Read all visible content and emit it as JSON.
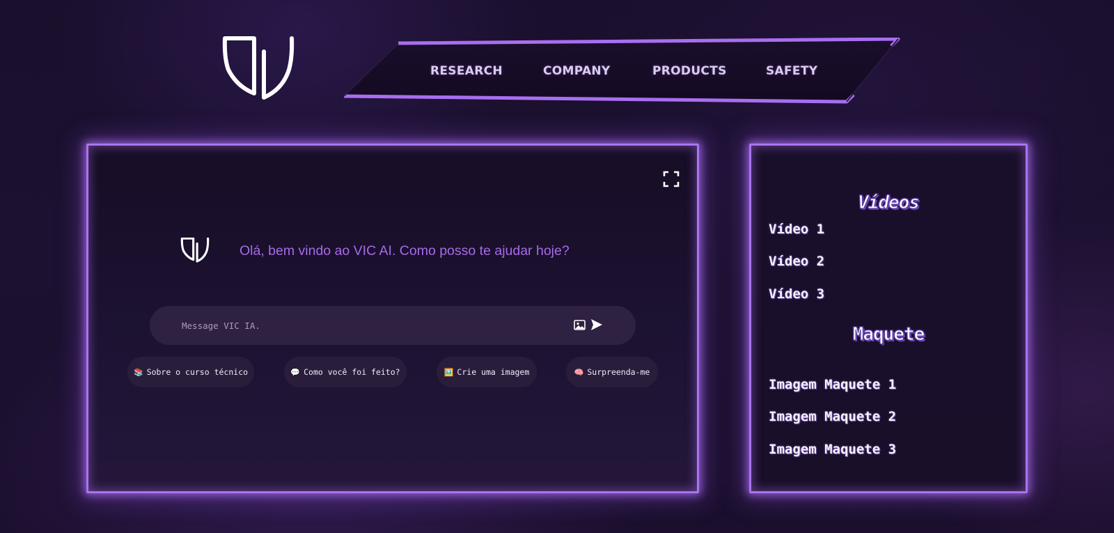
{
  "header": {
    "logo_icon": "vic-shield-logo-icon",
    "nav": [
      {
        "label": "RESEARCH"
      },
      {
        "label": "COMPANY"
      },
      {
        "label": "PRODUCTS"
      },
      {
        "label": "SAFETY"
      }
    ]
  },
  "chat": {
    "expand_icon": "fullscreen-expand-icon",
    "welcome_logo_icon": "vic-shield-logo-icon",
    "welcome_message": "Olá, bem vindo ao VIC AI. Como posso te ajudar hoje?",
    "input": {
      "placeholder": "Message VIC IA.",
      "value": ""
    },
    "image_icon": "image-upload-icon",
    "send_icon": "send-arrow-icon",
    "suggestions": [
      {
        "emoji": "📚",
        "label": "Sobre o curso técnico"
      },
      {
        "emoji": "💬",
        "label": "Como você foi feito?"
      },
      {
        "emoji": "🖼️",
        "label": "Crie uma imagem"
      },
      {
        "emoji": "🧠",
        "label": "Surpreenda-me"
      }
    ]
  },
  "sidebar": {
    "videos_title": "Vídeos",
    "videos": [
      {
        "label": "Vídeo 1"
      },
      {
        "label": "Vídeo 2"
      },
      {
        "label": "Vídeo 3"
      }
    ],
    "maquete_title": "Maquete",
    "maquete": [
      {
        "label": "Imagem Maquete 1"
      },
      {
        "label": "Imagem Maquete 2"
      },
      {
        "label": "Imagem Maquete 3"
      }
    ]
  },
  "colors": {
    "background": "#1b0f2d",
    "accent_purple": "#a974ee",
    "welcome_text": "#a66be8",
    "nav_text": "#d9ccf0",
    "input_bg": "#2f2142",
    "chip_bg": "#2a1d3c"
  }
}
